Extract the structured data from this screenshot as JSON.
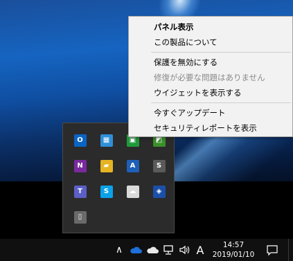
{
  "context_menu": {
    "items": [
      {
        "label": "パネル表示",
        "bold": true,
        "enabled": true
      },
      {
        "label": "この製品について",
        "bold": false,
        "enabled": true
      },
      {
        "separator": true
      },
      {
        "label": "保護を無効にする",
        "bold": false,
        "enabled": true
      },
      {
        "label": "修復が必要な問題はありません",
        "bold": false,
        "enabled": false
      },
      {
        "label": "ウイジェットを表示する",
        "bold": false,
        "enabled": true
      },
      {
        "separator": true
      },
      {
        "label": "今すぐアップデート",
        "bold": false,
        "enabled": true
      },
      {
        "label": "セキュリティレポートを表示",
        "bold": false,
        "enabled": true
      }
    ]
  },
  "tray_overflow": {
    "icons": [
      {
        "name": "outlook-icon",
        "glyph": "O",
        "color": "#0a64c4"
      },
      {
        "name": "network-monitor-icon",
        "glyph": "▦",
        "color": "#2f8fd8"
      },
      {
        "name": "green-app-icon",
        "glyph": "▣",
        "color": "#1f9a3a"
      },
      {
        "name": "green-tool-icon",
        "glyph": "◩",
        "color": "#3a8f2a"
      },
      {
        "name": "onenote-icon",
        "glyph": "N",
        "color": "#7a2a9e"
      },
      {
        "name": "folder-sync-icon",
        "glyph": "▰",
        "color": "#e6b422"
      },
      {
        "name": "arrow-app-icon",
        "glyph": "A",
        "color": "#1e5fb8"
      },
      {
        "name": "sync-circle-icon",
        "glyph": "S",
        "color": "#5a5a5a"
      },
      {
        "name": "teams-icon",
        "glyph": "T",
        "color": "#5b5fc7"
      },
      {
        "name": "skype-icon",
        "glyph": "S",
        "color": "#0aa2e8"
      },
      {
        "name": "cloud-upload-icon",
        "glyph": "☁",
        "color": "#d9d9d9"
      },
      {
        "name": "security-shield-icon",
        "glyph": "◈",
        "color": "#1b4fa8"
      },
      {
        "name": "usb-eject-icon",
        "glyph": "▯",
        "color": "#6a6a6a"
      }
    ]
  },
  "taskbar": {
    "chevron": "∧",
    "ime_label": "A",
    "time": "14:57",
    "date": "2019/01/10"
  }
}
